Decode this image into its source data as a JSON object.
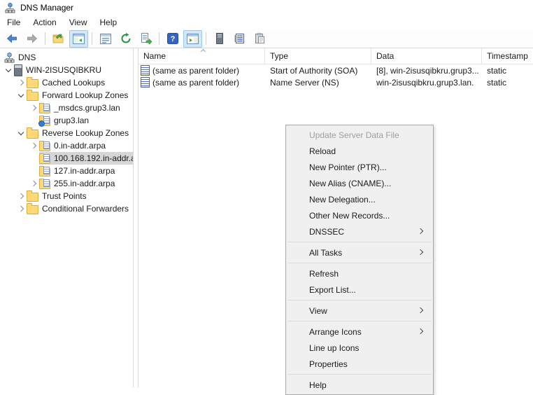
{
  "window": {
    "title": "DNS Manager"
  },
  "menubar": {
    "items": [
      {
        "label": "File"
      },
      {
        "label": "Action"
      },
      {
        "label": "View"
      },
      {
        "label": "Help"
      }
    ]
  },
  "toolbar": {
    "buttons": [
      "back",
      "forward",
      "up-one-level",
      "show-hide-console-tree",
      "properties",
      "refresh",
      "export-list",
      "help",
      "show-hide-action-pane",
      "server",
      "address-list",
      "clipboard"
    ],
    "toggled": [
      "show-hide-console-tree",
      "show-hide-action-pane"
    ]
  },
  "tree": {
    "items": [
      {
        "label": "DNS",
        "level": 0,
        "icon": "dns-network-icon",
        "state": "root"
      },
      {
        "label": "WIN-2ISUSQIBKRU",
        "level": 1,
        "icon": "server-icon",
        "state": "expanded"
      },
      {
        "label": "Cached Lookups",
        "level": 2,
        "icon": "folder-icon",
        "state": "collapsed"
      },
      {
        "label": "Forward Lookup Zones",
        "level": 2,
        "icon": "folder-icon",
        "state": "expanded"
      },
      {
        "label": "_msdcs.grup3.lan",
        "level": 3,
        "icon": "zone-icon",
        "state": "collapsed"
      },
      {
        "label": "grup3.lan",
        "level": 3,
        "icon": "zone-globe-icon",
        "state": "leaf"
      },
      {
        "label": "Reverse Lookup Zones",
        "level": 2,
        "icon": "folder-icon",
        "state": "expanded"
      },
      {
        "label": "0.in-addr.arpa",
        "level": 3,
        "icon": "zone-icon",
        "state": "collapsed"
      },
      {
        "label": "100.168.192.in-addr.a",
        "level": 3,
        "icon": "zone-icon",
        "state": "leaf",
        "selected": true
      },
      {
        "label": "127.in-addr.arpa",
        "level": 3,
        "icon": "zone-icon",
        "state": "leaf"
      },
      {
        "label": "255.in-addr.arpa",
        "level": 3,
        "icon": "zone-icon",
        "state": "collapsed"
      },
      {
        "label": "Trust Points",
        "level": 2,
        "icon": "folder-icon",
        "state": "collapsed"
      },
      {
        "label": "Conditional Forwarders",
        "level": 2,
        "icon": "folder-icon",
        "state": "collapsed"
      }
    ]
  },
  "records": {
    "columns": [
      {
        "label": "Name",
        "sort": "asc"
      },
      {
        "label": "Type"
      },
      {
        "label": "Data"
      },
      {
        "label": "Timestamp"
      }
    ],
    "rows": [
      {
        "name": "(same as parent folder)",
        "type": "Start of Authority (SOA)",
        "data": "[8], win-2isusqibkru.grup3...",
        "timestamp": "static"
      },
      {
        "name": "(same as parent folder)",
        "type": "Name Server (NS)",
        "data": "win-2isusqibkru.grup3.lan.",
        "timestamp": "static"
      }
    ]
  },
  "context_menu": {
    "items": [
      {
        "label": "Update Server Data File",
        "disabled": true
      },
      {
        "label": "Reload"
      },
      {
        "label": "New Pointer (PTR)..."
      },
      {
        "label": "New Alias (CNAME)..."
      },
      {
        "label": "New Delegation..."
      },
      {
        "label": "Other New Records..."
      },
      {
        "label": "DNSSEC",
        "submenu": true
      },
      {
        "label": "All Tasks",
        "submenu": true
      },
      {
        "label": "Refresh"
      },
      {
        "label": "Export List..."
      },
      {
        "label": "View",
        "submenu": true
      },
      {
        "label": "Arrange Icons",
        "submenu": true
      },
      {
        "label": "Line up Icons"
      },
      {
        "label": "Properties"
      },
      {
        "label": "Help"
      }
    ]
  },
  "colors": {
    "selection_inactive": "#d6d6d6",
    "toolbar_toggle_bg": "#cfe8fb",
    "toolbar_toggle_border": "#9ac9ee",
    "menu_bg": "#f0f0f0",
    "menu_border": "#a9a9a9",
    "disabled_text": "#9f9f9f",
    "folder_yellow": "#ffd978",
    "help_blue": "#3465c0"
  }
}
